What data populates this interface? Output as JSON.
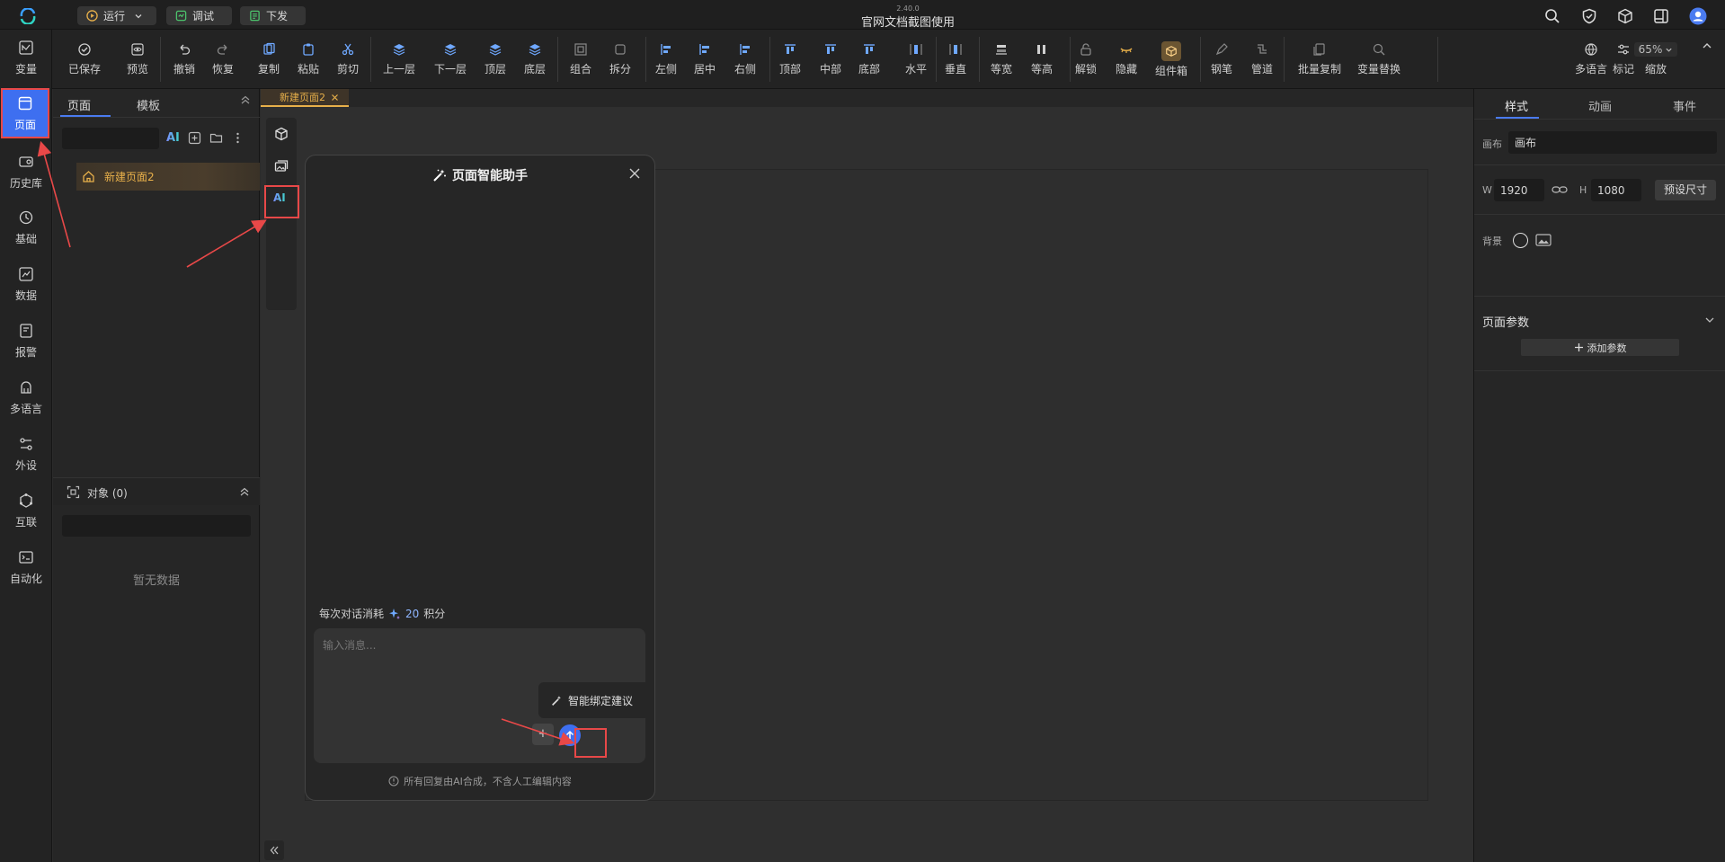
{
  "app": {
    "version": "2.40.0",
    "title": "官网文档截图使用"
  },
  "topbar": {
    "run_label": "运行",
    "debug_label": "调试",
    "deploy_label": "下发"
  },
  "toolbar": {
    "items": [
      "已保存",
      "预览",
      "撤销",
      "恢复",
      "复制",
      "粘贴",
      "剪切",
      "上一层",
      "下一层",
      "顶层",
      "底层",
      "组合",
      "拆分",
      "左侧",
      "居中",
      "右侧",
      "顶部",
      "中部",
      "底部",
      "水平",
      "垂直",
      "等宽",
      "等高",
      "解锁",
      "隐藏",
      "组件箱",
      "钢笔",
      "管道",
      "批量复制",
      "变量替换"
    ],
    "right_items": [
      "多语言",
      "标记",
      "缩放"
    ],
    "zoom": "65%"
  },
  "rail": {
    "items": [
      "变量",
      "页面",
      "历史库",
      "基础",
      "数据",
      "报警",
      "多语言",
      "外设",
      "互联",
      "自动化"
    ]
  },
  "leftpanel": {
    "tabs": [
      "页面",
      "模板"
    ],
    "ai_label": "AI",
    "page_item": "新建页面2",
    "objects_label": "对象 (0)",
    "empty_text": "暂无数据"
  },
  "canvas": {
    "tab_label": "新建页面2"
  },
  "ai_dialog": {
    "title": "页面智能助手",
    "cost_prefix": "每次对话消耗",
    "cost_value": "20",
    "cost_unit": "积分",
    "input_placeholder": "输入消息...",
    "suggest_label": "智能绑定建议",
    "plus_label": "+",
    "disclaimer": "所有回复由AI合成，不含人工编辑内容"
  },
  "rightpanel": {
    "tabs": [
      "样式",
      "动画",
      "事件"
    ],
    "canvas_label": "画布",
    "canvas_value": "画布",
    "w_label": "W",
    "w_value": "1920",
    "h_label": "H",
    "h_value": "1080",
    "preset_label": "预设尺寸",
    "bg_label": "背景",
    "params_label": "页面参数",
    "add_param_label": "添加参数"
  }
}
